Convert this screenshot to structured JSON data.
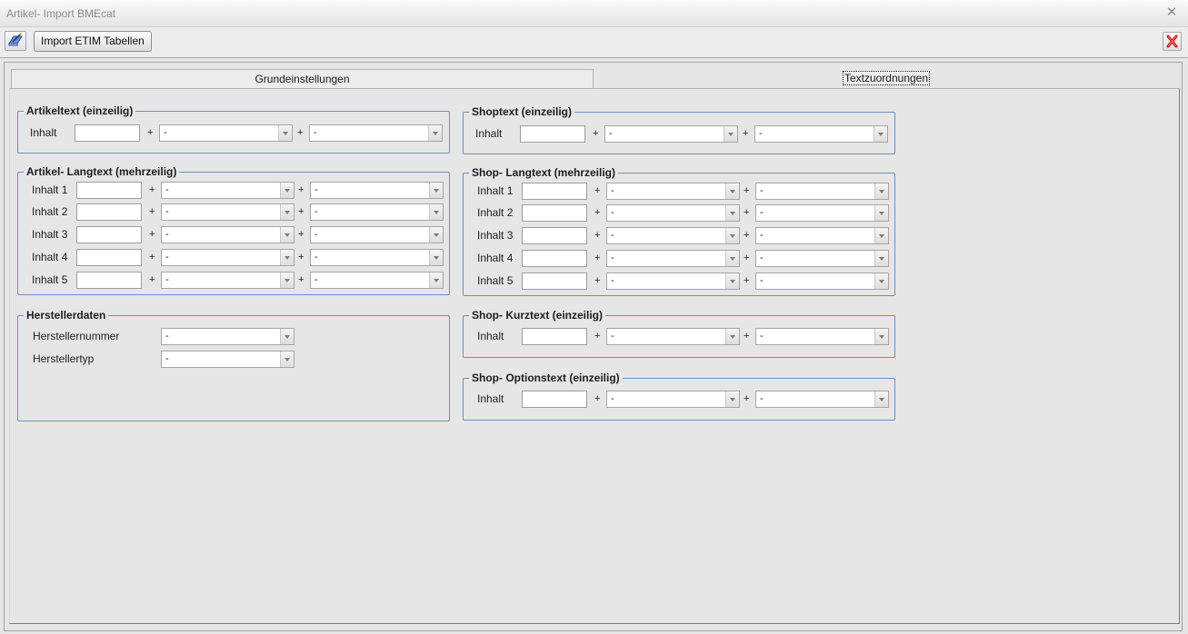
{
  "window": {
    "title": "Artikel- Import BMEcat",
    "close_glyph": "✕"
  },
  "toolbar": {
    "import_etim_label": "Import ETIM Tabellen"
  },
  "tabs": [
    {
      "label": "Grundeinstellungen"
    },
    {
      "label": "Textzuordnungen"
    }
  ],
  "groups": {
    "artikeltext": {
      "title": "Artikeltext (einzeilig)"
    },
    "artikel_langtext": {
      "title": "Artikel- Langtext (mehrzeilig)"
    },
    "herstellerdaten": {
      "title": "Herstellerdaten"
    },
    "shoptext": {
      "title": "Shoptext (einzeilig)"
    },
    "shop_langtext": {
      "title": "Shop- Langtext (mehrzeilig)"
    },
    "shop_kurztext": {
      "title": "Shop- Kurztext (einzeilig)"
    },
    "shop_optionstext": {
      "title": "Shop- Optionstext (einzeilig)"
    }
  },
  "labels": {
    "inhalt": "Inhalt",
    "inhalt_1": "Inhalt 1",
    "inhalt_2": "Inhalt 2",
    "inhalt_3": "Inhalt 3",
    "inhalt_4": "Inhalt 4",
    "inhalt_5": "Inhalt 5",
    "herstellernummer": "Herstellernummer",
    "herstellertyp": "Herstellertyp",
    "plus": "+"
  },
  "combo_value": "-",
  "icons": {
    "toolbar_left": "notebook-pen-icon",
    "toolbar_close": "red-x-close-icon"
  },
  "colors": {
    "group_border": "#6e8fbf",
    "close_red": "#cc1111"
  }
}
